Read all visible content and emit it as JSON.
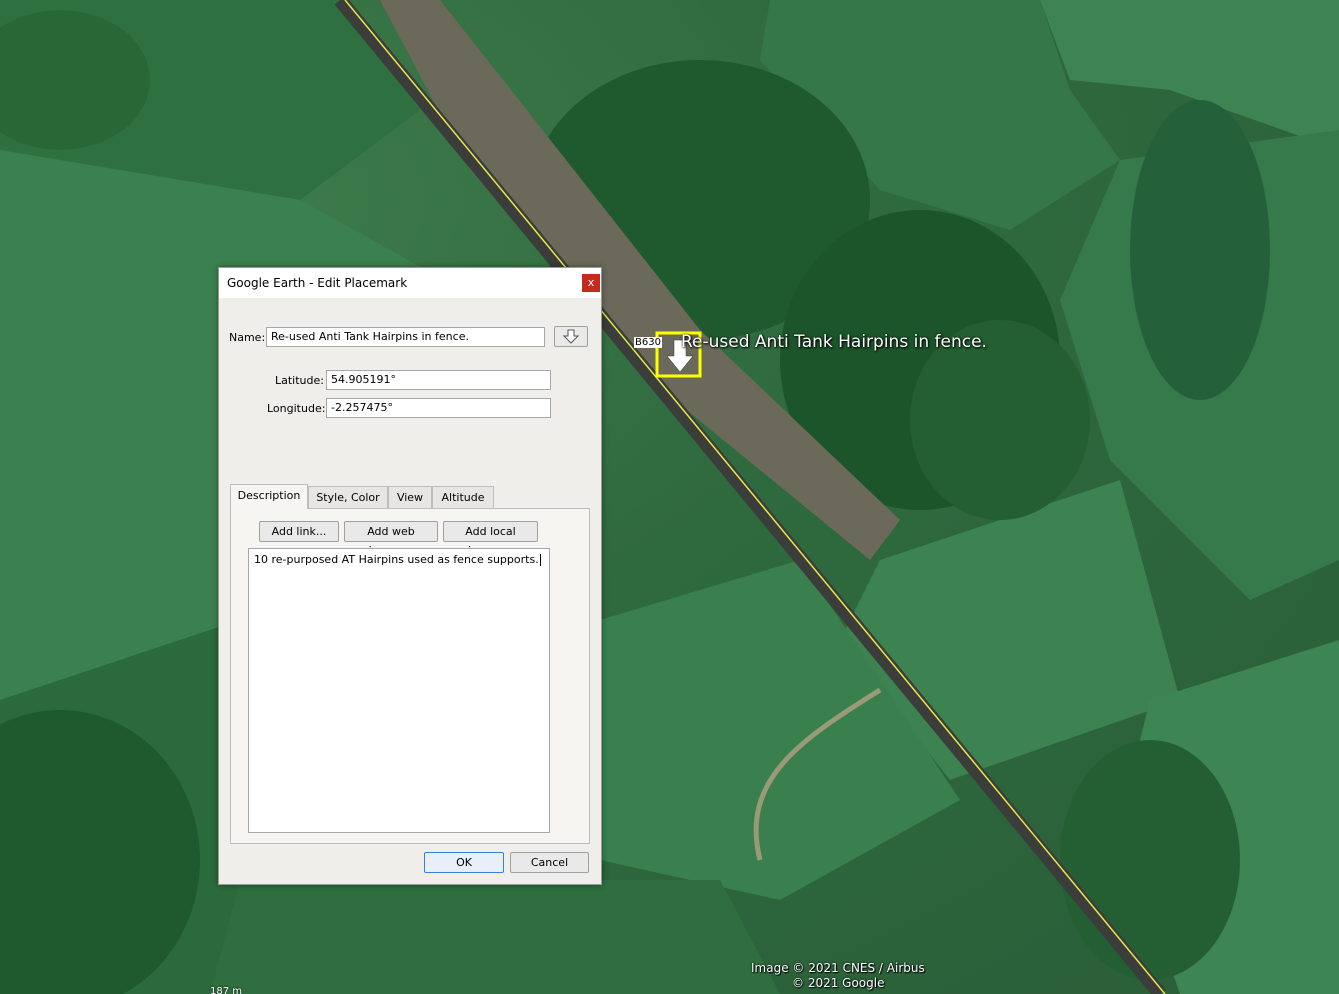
{
  "map": {
    "placemark_label": "Re-used Anti Tank Hairpins in fence.",
    "road_badge": "B630",
    "attribution": [
      "Image © 2021 CNES / Airbus",
      "© 2021 Google"
    ],
    "scale": "187 m"
  },
  "dialog": {
    "title": "Google Earth - Edit Placemark",
    "close_label": "x",
    "name_label": "Name:",
    "name_value": "Re-used Anti Tank Hairpins in fence.",
    "latitude_label": "Latitude:",
    "latitude_value": "54.905191°",
    "longitude_label": "Longitude:",
    "longitude_value": "-2.257475°",
    "tabs": [
      "Description",
      "Style, Color",
      "View",
      "Altitude"
    ],
    "buttons": {
      "add_link": "Add link...",
      "add_web_image": "Add web image...",
      "add_local_image": "Add local image..."
    },
    "description_text": "10 re-purposed AT Hairpins used as fence supports.",
    "ok_label": "OK",
    "cancel_label": "Cancel"
  },
  "colors": {
    "accent": "#3c7fd6",
    "close": "#c42b1c",
    "placemark": "#ffff00"
  }
}
